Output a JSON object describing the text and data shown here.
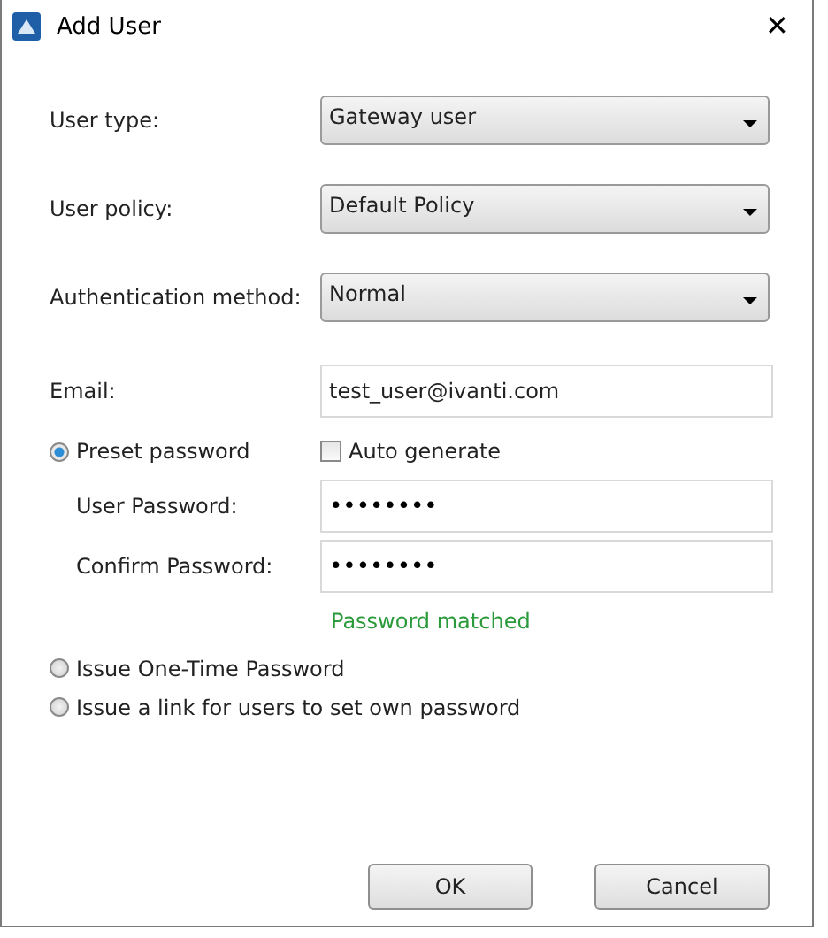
{
  "window": {
    "title": "Add User",
    "close": "✕"
  },
  "dropdowns": [
    {
      "label": "User type:",
      "value": "Gateway user"
    },
    {
      "label": "User policy:",
      "value": "Default Policy"
    },
    {
      "label": "Authentication method:",
      "value": "Normal"
    }
  ],
  "email": {
    "label": "Email:",
    "value": "test_user@ivanti.com"
  },
  "password_options": [
    {
      "label": "Preset password",
      "selected": true
    },
    {
      "label": "Issue One-Time Password",
      "selected": false
    },
    {
      "label": "Issue a link for users to set own password",
      "selected": false
    }
  ],
  "auto_generate": {
    "label": "Auto generate",
    "checked": false
  },
  "password_fields": [
    {
      "label": "User Password:",
      "value": "••••••••"
    },
    {
      "label": "Confirm Password:",
      "value": "••••••••"
    }
  ],
  "match_message": "Password matched",
  "buttons": [
    "OK",
    "Cancel"
  ]
}
